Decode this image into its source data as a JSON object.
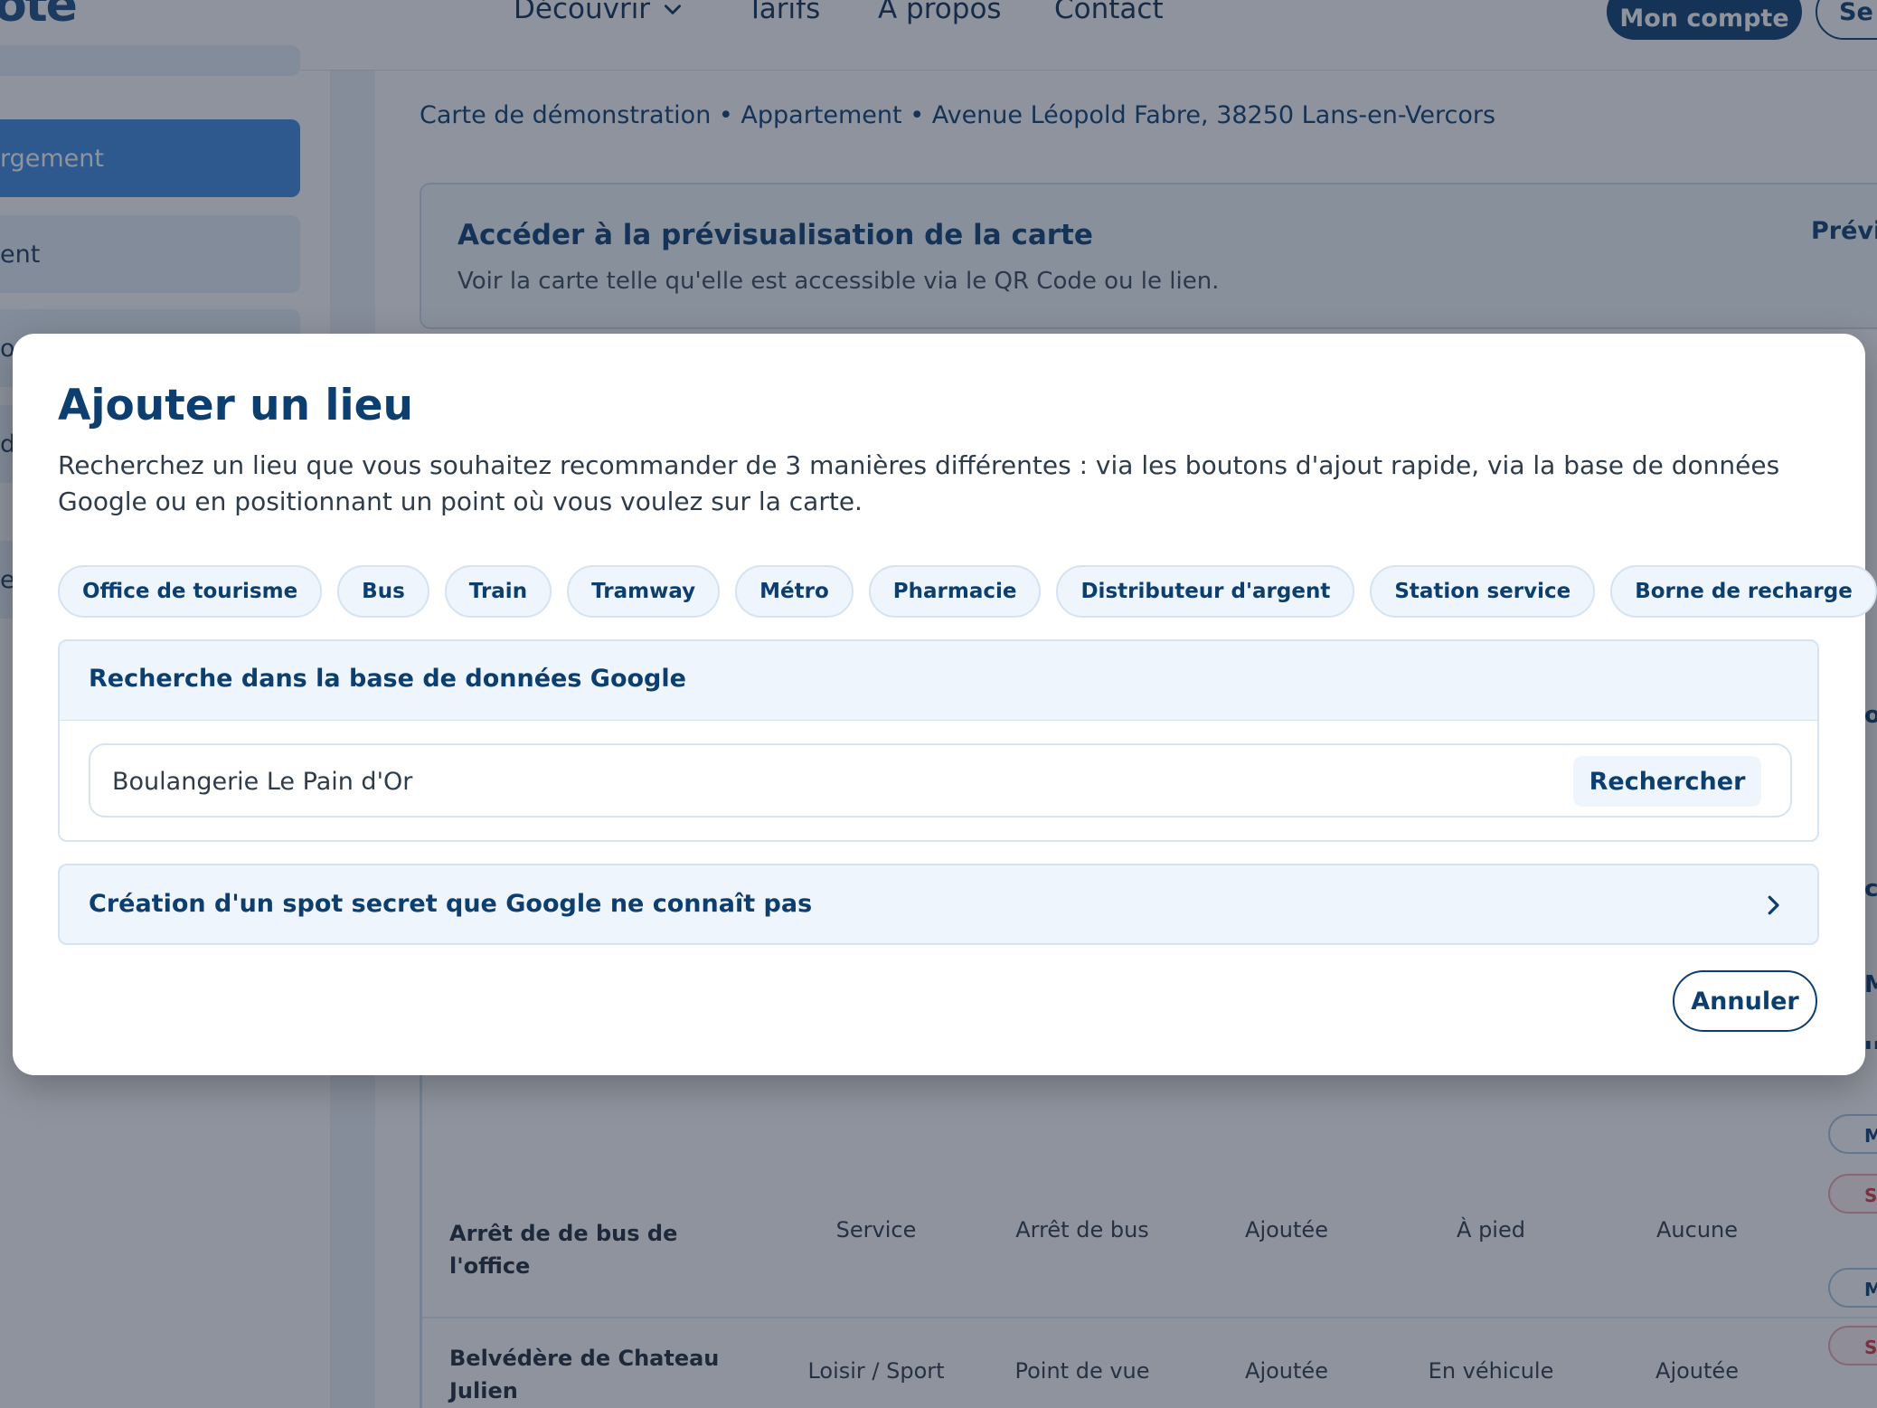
{
  "header": {
    "logo_text": "ote",
    "nav": [
      "Découvrir",
      "Tarifs",
      "À propos",
      "Contact"
    ],
    "account_label": "Mon compte",
    "second_button": "Se"
  },
  "sidebar": {
    "items": [
      "rgement",
      "ent",
      "o",
      "d",
      "e"
    ]
  },
  "breadcrumb": "Carte de démonstration • Appartement • Avenue Léopold Fabre, 38250 Lans-en-Vercors",
  "preview": {
    "title": "Accéder à la prévisualisation de la carte",
    "description": "Voir la carte telle qu'elle est accessible via le QR Code ou le lien.",
    "link": "Prévis"
  },
  "table": {
    "rows": [
      {
        "name": "Arrêt de de bus de l'office",
        "category": "Service",
        "type": "Arrêt de bus",
        "status": "Ajoutée",
        "access": "À pied",
        "extra": "Aucune"
      },
      {
        "name": "Belvédère de Chateau Julien",
        "category": "Loisir / Sport",
        "type": "Point de vue",
        "status": "Ajoutée",
        "access": "En véhicule",
        "extra": "Ajoutée"
      }
    ],
    "row_action_edit": "M",
    "row_action_delete": "Su",
    "edge_letters": [
      "o",
      "c",
      "M",
      "u"
    ]
  },
  "modal": {
    "title": "Ajouter un lieu",
    "description": "Recherchez un lieu que vous souhaitez recommander de 3 manières différentes : via les boutons d'ajout rapide, via la base de données Google ou en positionnant un point où vous voulez sur la carte.",
    "quick_add": [
      "Office de tourisme",
      "Bus",
      "Train",
      "Tramway",
      "Métro",
      "Pharmacie",
      "Distributeur d'argent",
      "Station service",
      "Borne de recharge"
    ],
    "google_section_title": "Recherche dans la base de données Google",
    "search_value": "Boulangerie Le Pain d'Or",
    "search_button": "Rechercher",
    "secret_spot_label": "Création d'un spot secret que Google ne connaît pas",
    "cancel_label": "Annuler"
  }
}
